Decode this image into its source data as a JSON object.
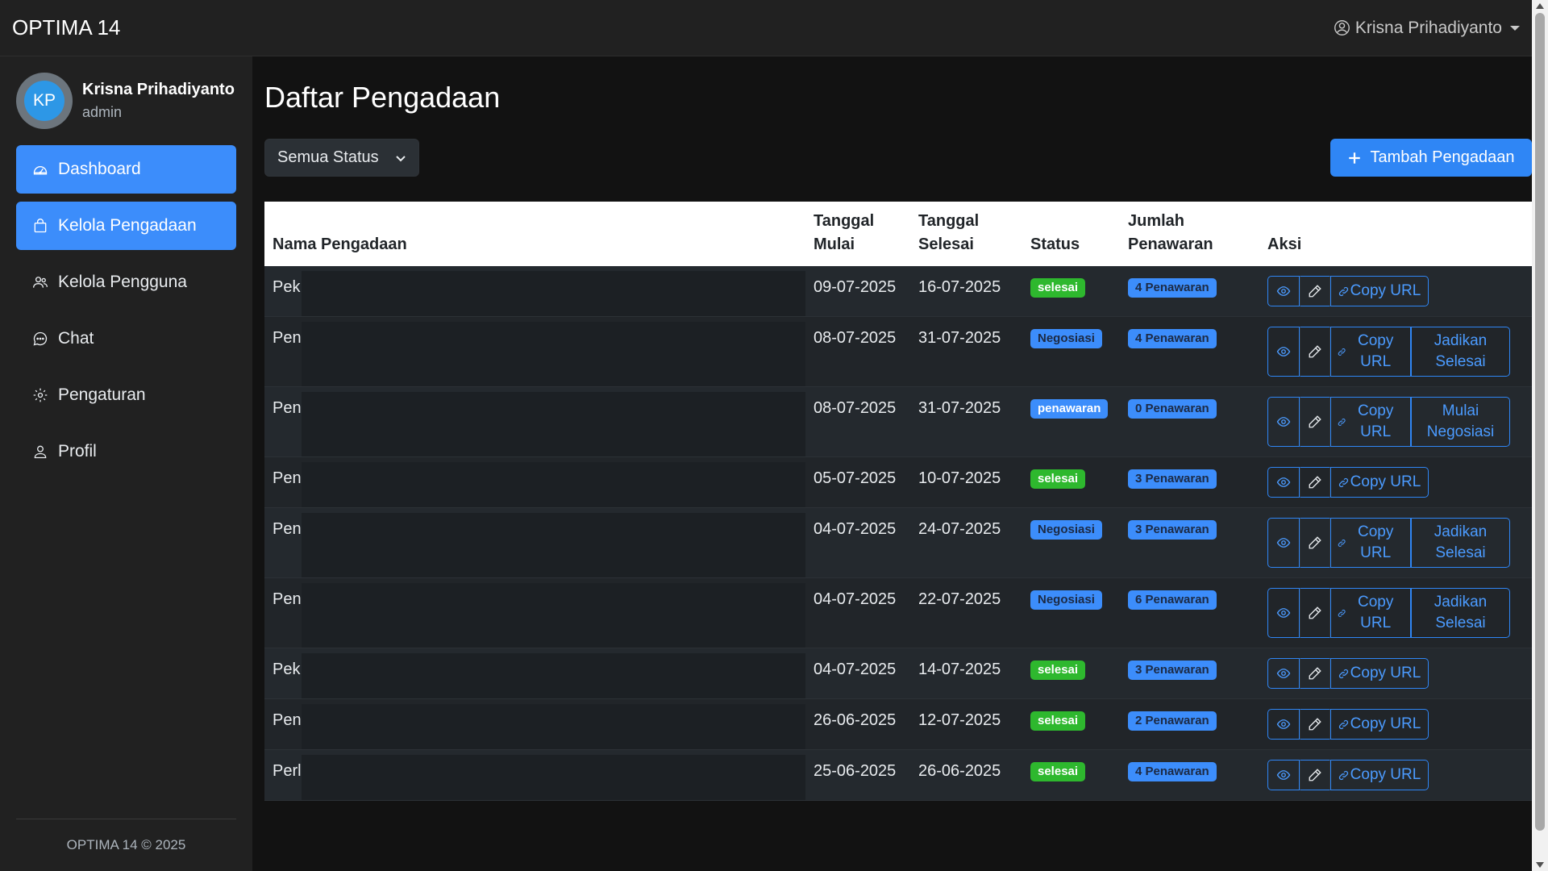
{
  "app": {
    "brand": "OPTIMA 14"
  },
  "topbar": {
    "user_name": "Krisna Prihadiyanto"
  },
  "sidebar": {
    "avatar_initials": "KP",
    "user_name": "Krisna Prihadiyanto",
    "user_role": "admin",
    "items": [
      {
        "label": "Dashboard",
        "icon": "dashboard-icon",
        "active": true
      },
      {
        "label": "Kelola Pengadaan",
        "icon": "bag-icon",
        "active": true
      },
      {
        "label": "Kelola Pengguna",
        "icon": "users-icon",
        "active": false
      },
      {
        "label": "Chat",
        "icon": "chat-icon",
        "active": false
      },
      {
        "label": "Pengaturan",
        "icon": "gear-icon",
        "active": false
      },
      {
        "label": "Profil",
        "icon": "person-icon",
        "active": false
      }
    ],
    "footer": "OPTIMA 14 © 2025"
  },
  "main": {
    "title": "Daftar Pengadaan",
    "filter_label": "Semua Status",
    "add_button_label": "Tambah Pengadaan",
    "table": {
      "headers": {
        "name": "Nama Pengadaan",
        "start": "Tanggal Mulai",
        "end": "Tanggal Selesai",
        "status": "Status",
        "offers": "Jumlah Penawaran",
        "actions": "Aksi"
      },
      "copy_url_label": "Copy URL",
      "rows": [
        {
          "name": "Pek Kan",
          "start": "09-07-2025",
          "end": "16-07-2025",
          "status": "selesai",
          "offers": "4 Penawaran",
          "extra_action": ""
        },
        {
          "name": "Pen",
          "start": "08-07-2025",
          "end": "31-07-2025",
          "status": "Negosiasi",
          "offers": "4 Penawaran",
          "extra_action": "Jadikan Selesai"
        },
        {
          "name": "Pen",
          "start": "08-07-2025",
          "end": "31-07-2025",
          "status": "penawaran",
          "offers": "0 Penawaran",
          "extra_action": "Mulai Negosiasi"
        },
        {
          "name": "Pen",
          "start": "05-07-2025",
          "end": "10-07-2025",
          "status": "selesai",
          "offers": "3 Penawaran",
          "extra_action": ""
        },
        {
          "name": "Pen",
          "start": "04-07-2025",
          "end": "24-07-2025",
          "status": "Negosiasi",
          "offers": "3 Penawaran",
          "extra_action": "Jadikan Selesai"
        },
        {
          "name": "Pen",
          "start": "04-07-2025",
          "end": "22-07-2025",
          "status": "Negosiasi",
          "offers": "6 Penawaran",
          "extra_action": "Jadikan Selesai"
        },
        {
          "name": "Pek Kan",
          "start": "04-07-2025",
          "end": "14-07-2025",
          "status": "selesai",
          "offers": "3 Penawaran",
          "extra_action": ""
        },
        {
          "name": "Pen",
          "start": "26-06-2025",
          "end": "12-07-2025",
          "status": "selesai",
          "offers": "2 Penawaran",
          "extra_action": ""
        },
        {
          "name": "Perl",
          "start": "25-06-2025",
          "end": "26-06-2025",
          "status": "selesai",
          "offers": "4 Penawaran",
          "extra_action": ""
        }
      ]
    }
  },
  "colors": {
    "primary": "#3c8dfb",
    "success": "#2eb82e",
    "sidebar_bg": "#212121",
    "page_bg": "#121212"
  }
}
